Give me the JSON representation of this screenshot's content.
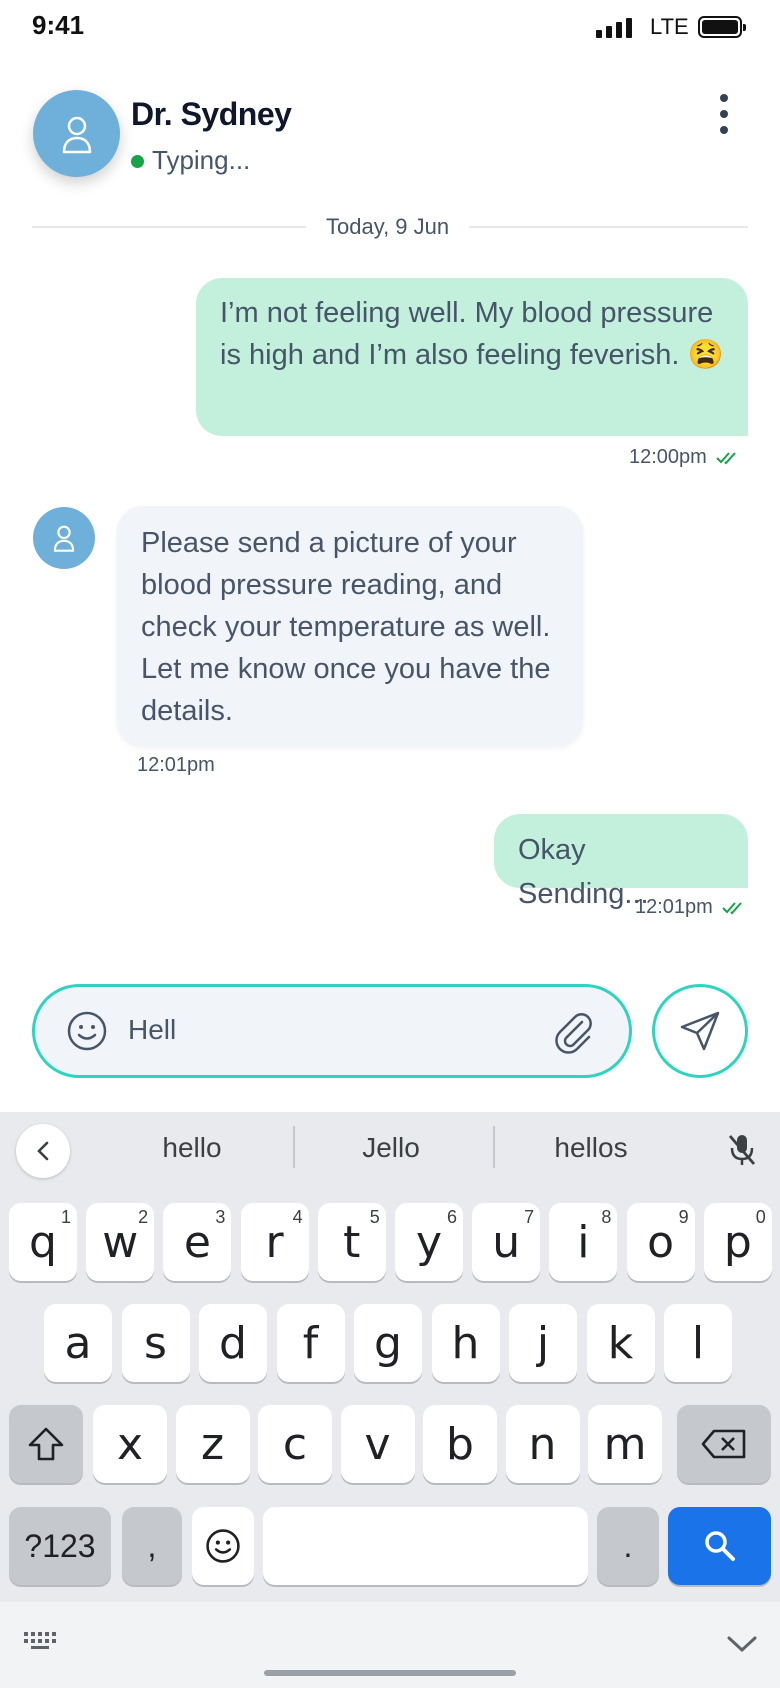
{
  "status_bar": {
    "time": "9:41",
    "network": "LTE"
  },
  "header": {
    "name": "Dr. Sydney",
    "status": "Typing...",
    "status_color": "#16a34a"
  },
  "date_divider": "Today, 9 Jun",
  "messages": [
    {
      "from": "me",
      "text": "I’m not feeling well. My blood pressure is high and I’m also feeling feverish.",
      "emoji": "😫",
      "time": "12:00pm",
      "read": true
    },
    {
      "from": "doctor",
      "text": "Please send a picture of your blood pressure reading, and check your temperature as well. Let me know once you have the details.",
      "time": "12:01pm"
    },
    {
      "from": "me",
      "text": "Okay Sending...",
      "time": "12:01pm",
      "read": true
    }
  ],
  "composer": {
    "value": "Hell",
    "accent": "#2dd4bf"
  },
  "keyboard": {
    "suggestions": [
      "hello",
      "Jello",
      "hellos"
    ],
    "row1": [
      {
        "k": "q",
        "n": "1"
      },
      {
        "k": "w",
        "n": "2"
      },
      {
        "k": "e",
        "n": "3"
      },
      {
        "k": "r",
        "n": "4"
      },
      {
        "k": "t",
        "n": "5"
      },
      {
        "k": "y",
        "n": "6"
      },
      {
        "k": "u",
        "n": "7"
      },
      {
        "k": "i",
        "n": "8"
      },
      {
        "k": "o",
        "n": "9"
      },
      {
        "k": "p",
        "n": "0"
      }
    ],
    "row2": [
      "a",
      "s",
      "d",
      "f",
      "g",
      "h",
      "j",
      "k",
      "l"
    ],
    "row3": [
      "x",
      "z",
      "c",
      "v",
      "b",
      "n",
      "m"
    ],
    "symbols_label": "?123",
    "comma": ",",
    "period": ".",
    "accent": "#1a73e8"
  }
}
